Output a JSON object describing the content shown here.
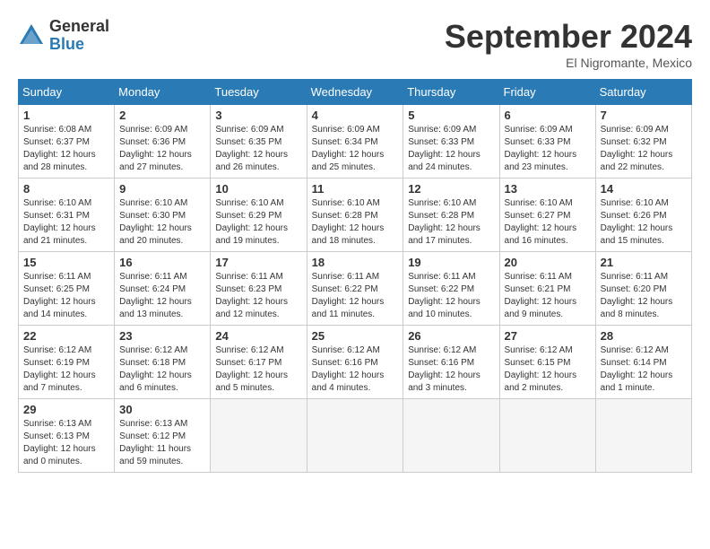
{
  "logo": {
    "general": "General",
    "blue": "Blue"
  },
  "title": "September 2024",
  "location": "El Nigromante, Mexico",
  "days_of_week": [
    "Sunday",
    "Monday",
    "Tuesday",
    "Wednesday",
    "Thursday",
    "Friday",
    "Saturday"
  ],
  "weeks": [
    [
      {
        "day": "1",
        "info": "Sunrise: 6:08 AM\nSunset: 6:37 PM\nDaylight: 12 hours\nand 28 minutes."
      },
      {
        "day": "2",
        "info": "Sunrise: 6:09 AM\nSunset: 6:36 PM\nDaylight: 12 hours\nand 27 minutes."
      },
      {
        "day": "3",
        "info": "Sunrise: 6:09 AM\nSunset: 6:35 PM\nDaylight: 12 hours\nand 26 minutes."
      },
      {
        "day": "4",
        "info": "Sunrise: 6:09 AM\nSunset: 6:34 PM\nDaylight: 12 hours\nand 25 minutes."
      },
      {
        "day": "5",
        "info": "Sunrise: 6:09 AM\nSunset: 6:33 PM\nDaylight: 12 hours\nand 24 minutes."
      },
      {
        "day": "6",
        "info": "Sunrise: 6:09 AM\nSunset: 6:33 PM\nDaylight: 12 hours\nand 23 minutes."
      },
      {
        "day": "7",
        "info": "Sunrise: 6:09 AM\nSunset: 6:32 PM\nDaylight: 12 hours\nand 22 minutes."
      }
    ],
    [
      {
        "day": "8",
        "info": "Sunrise: 6:10 AM\nSunset: 6:31 PM\nDaylight: 12 hours\nand 21 minutes."
      },
      {
        "day": "9",
        "info": "Sunrise: 6:10 AM\nSunset: 6:30 PM\nDaylight: 12 hours\nand 20 minutes."
      },
      {
        "day": "10",
        "info": "Sunrise: 6:10 AM\nSunset: 6:29 PM\nDaylight: 12 hours\nand 19 minutes."
      },
      {
        "day": "11",
        "info": "Sunrise: 6:10 AM\nSunset: 6:28 PM\nDaylight: 12 hours\nand 18 minutes."
      },
      {
        "day": "12",
        "info": "Sunrise: 6:10 AM\nSunset: 6:28 PM\nDaylight: 12 hours\nand 17 minutes."
      },
      {
        "day": "13",
        "info": "Sunrise: 6:10 AM\nSunset: 6:27 PM\nDaylight: 12 hours\nand 16 minutes."
      },
      {
        "day": "14",
        "info": "Sunrise: 6:10 AM\nSunset: 6:26 PM\nDaylight: 12 hours\nand 15 minutes."
      }
    ],
    [
      {
        "day": "15",
        "info": "Sunrise: 6:11 AM\nSunset: 6:25 PM\nDaylight: 12 hours\nand 14 minutes."
      },
      {
        "day": "16",
        "info": "Sunrise: 6:11 AM\nSunset: 6:24 PM\nDaylight: 12 hours\nand 13 minutes."
      },
      {
        "day": "17",
        "info": "Sunrise: 6:11 AM\nSunset: 6:23 PM\nDaylight: 12 hours\nand 12 minutes."
      },
      {
        "day": "18",
        "info": "Sunrise: 6:11 AM\nSunset: 6:22 PM\nDaylight: 12 hours\nand 11 minutes."
      },
      {
        "day": "19",
        "info": "Sunrise: 6:11 AM\nSunset: 6:22 PM\nDaylight: 12 hours\nand 10 minutes."
      },
      {
        "day": "20",
        "info": "Sunrise: 6:11 AM\nSunset: 6:21 PM\nDaylight: 12 hours\nand 9 minutes."
      },
      {
        "day": "21",
        "info": "Sunrise: 6:11 AM\nSunset: 6:20 PM\nDaylight: 12 hours\nand 8 minutes."
      }
    ],
    [
      {
        "day": "22",
        "info": "Sunrise: 6:12 AM\nSunset: 6:19 PM\nDaylight: 12 hours\nand 7 minutes."
      },
      {
        "day": "23",
        "info": "Sunrise: 6:12 AM\nSunset: 6:18 PM\nDaylight: 12 hours\nand 6 minutes."
      },
      {
        "day": "24",
        "info": "Sunrise: 6:12 AM\nSunset: 6:17 PM\nDaylight: 12 hours\nand 5 minutes."
      },
      {
        "day": "25",
        "info": "Sunrise: 6:12 AM\nSunset: 6:16 PM\nDaylight: 12 hours\nand 4 minutes."
      },
      {
        "day": "26",
        "info": "Sunrise: 6:12 AM\nSunset: 6:16 PM\nDaylight: 12 hours\nand 3 minutes."
      },
      {
        "day": "27",
        "info": "Sunrise: 6:12 AM\nSunset: 6:15 PM\nDaylight: 12 hours\nand 2 minutes."
      },
      {
        "day": "28",
        "info": "Sunrise: 6:12 AM\nSunset: 6:14 PM\nDaylight: 12 hours\nand 1 minute."
      }
    ],
    [
      {
        "day": "29",
        "info": "Sunrise: 6:13 AM\nSunset: 6:13 PM\nDaylight: 12 hours\nand 0 minutes."
      },
      {
        "day": "30",
        "info": "Sunrise: 6:13 AM\nSunset: 6:12 PM\nDaylight: 11 hours\nand 59 minutes."
      },
      {
        "day": "",
        "info": ""
      },
      {
        "day": "",
        "info": ""
      },
      {
        "day": "",
        "info": ""
      },
      {
        "day": "",
        "info": ""
      },
      {
        "day": "",
        "info": ""
      }
    ]
  ]
}
